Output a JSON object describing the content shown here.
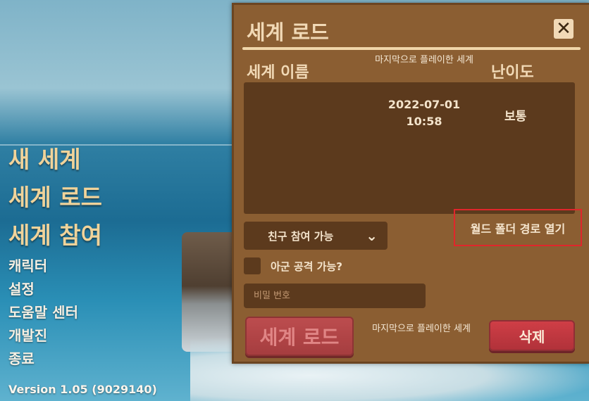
{
  "menu": {
    "new_world": "새 세계",
    "load_world": "세계 로드",
    "join_world": "세계 참여",
    "character": "캐릭터",
    "settings": "설정",
    "help_center": "도움말 센터",
    "developer": "개발진",
    "quit": "종료"
  },
  "version": "Version 1.05 (9029140)",
  "dialog": {
    "title": "세계 로드",
    "columns": {
      "name": "세계 이름",
      "last_played": "마지막으로 플레이한 세계",
      "difficulty": "난이도"
    },
    "worlds": [
      {
        "name": "",
        "date": "2022-07-01",
        "time": "10:58",
        "difficulty": "보통"
      }
    ],
    "visibility_select": "친구 참여 가능",
    "open_folder": "월드 폴더 경로 열기",
    "friendly_fire_label": "아군 공격 가능?",
    "password_placeholder": "비밀 번호",
    "load_button": "세계 로드",
    "footer_last_played": "마지막으로 플레이한 세계",
    "delete_button": "삭제"
  },
  "icons": {
    "close": "close-icon",
    "dropdown": "chevron-down-icon"
  },
  "colors": {
    "accent": "#f0d39a",
    "panel": "#8b5e32",
    "field": "#5c3a1d",
    "highlight_box": "#e0262b",
    "danger": "#c24b52"
  }
}
